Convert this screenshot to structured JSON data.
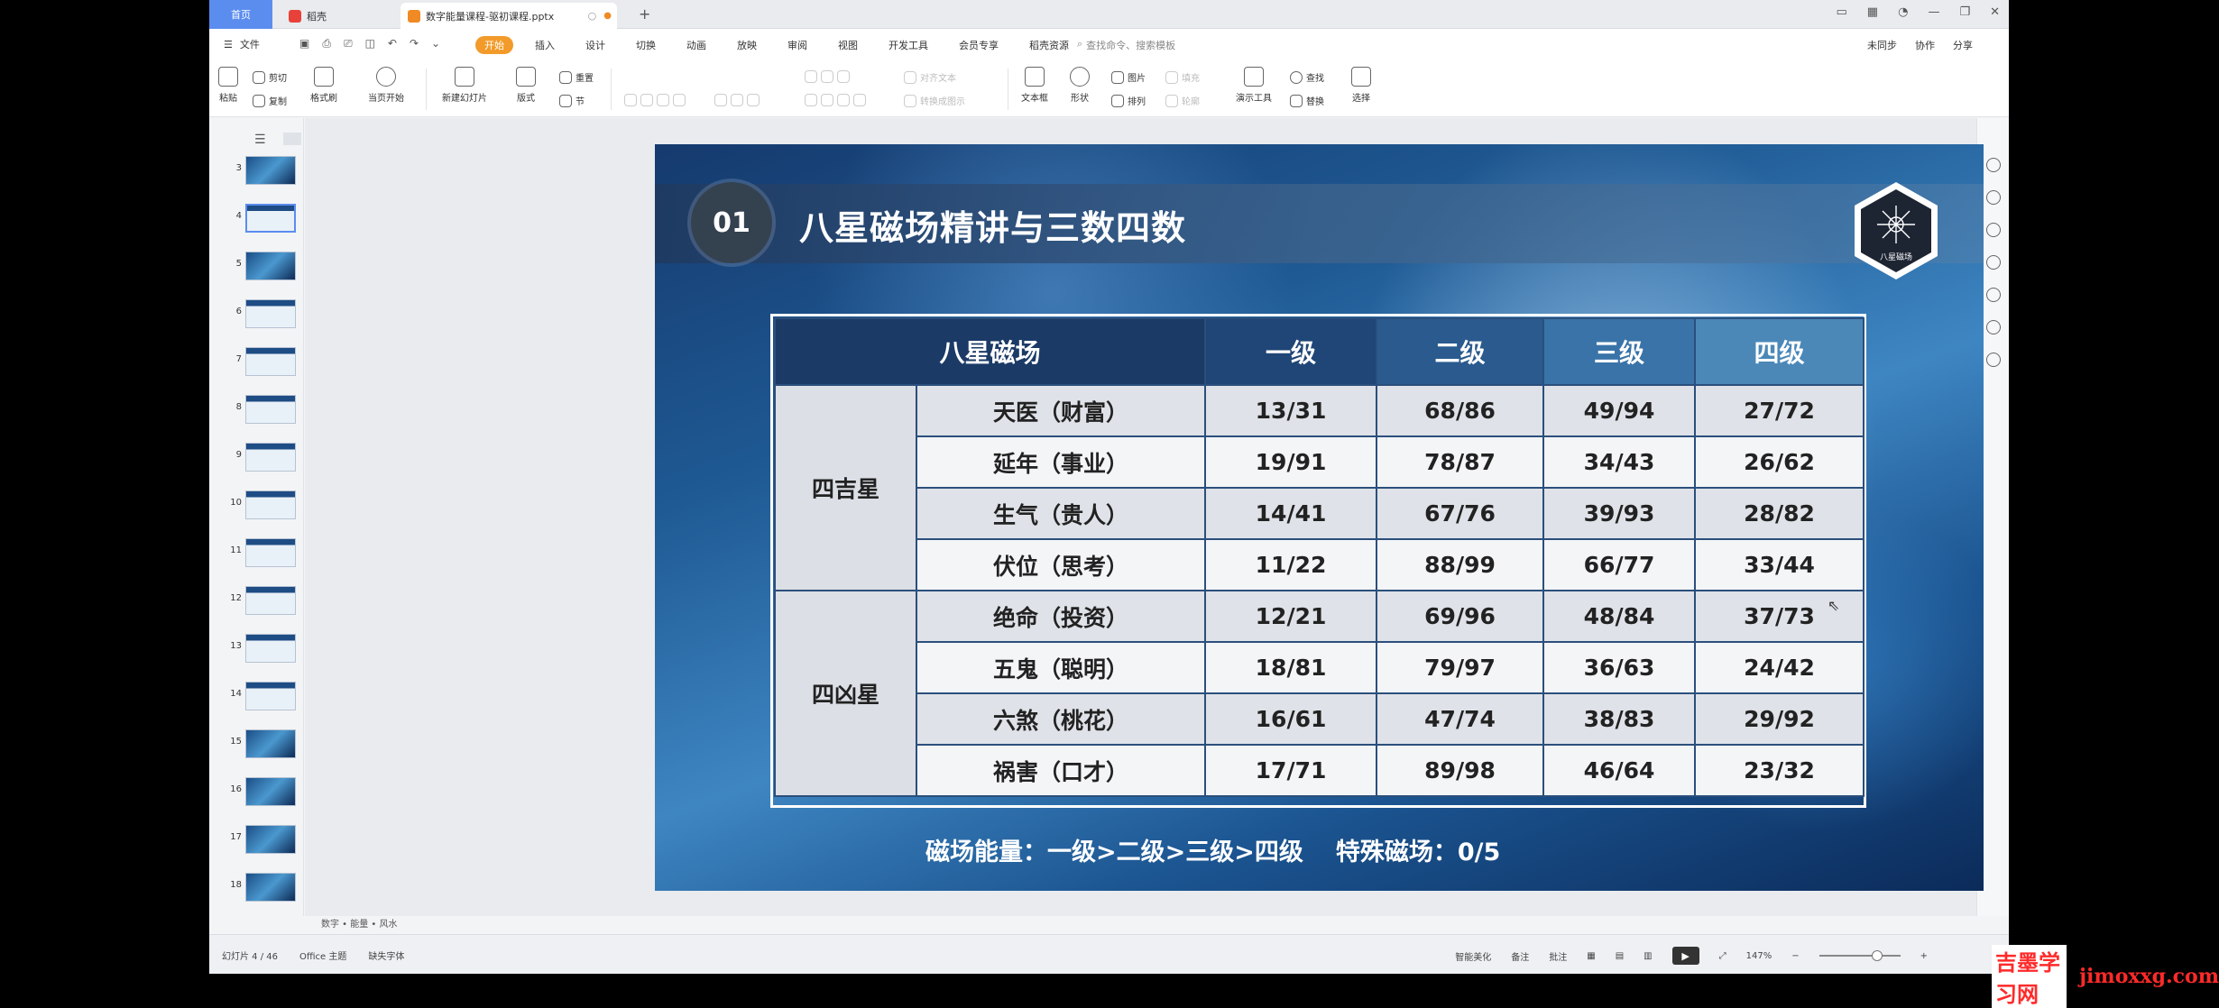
{
  "tabs": {
    "home": "首页",
    "docer": "稻壳",
    "active_doc": "数字能量课程-驱初课程.pptx",
    "add": "+"
  },
  "menu": {
    "file": "文件",
    "tabs": [
      "开始",
      "插入",
      "设计",
      "切换",
      "动画",
      "放映",
      "审阅",
      "视图",
      "开发工具",
      "会员专享",
      "稻壳资源"
    ],
    "active_tab": "开始",
    "search": "查找命令、搜索模板",
    "right": [
      "未同步",
      "协作",
      "分享"
    ]
  },
  "ribbon": {
    "paste": "粘贴",
    "cut": "剪切",
    "copy": "复制",
    "format_painter": "格式刷",
    "play": "当页开始",
    "new_slide": "新建幻灯片",
    "layout": "版式",
    "section": "节",
    "reset": "重置",
    "text_box": "文本框",
    "shape": "形状",
    "arrange": "排列",
    "outline": "轮廓",
    "picture": "图片",
    "fill": "填充",
    "present_tools": "演示工具",
    "find": "查找",
    "replace": "替换",
    "select": "选择",
    "convert_smartart": "转换成图示",
    "text_direction": "对齐文本"
  },
  "thumbnails": [
    {
      "num": "3",
      "style": "dark"
    },
    {
      "num": "4",
      "style": "light",
      "active": true
    },
    {
      "num": "5",
      "style": "dark"
    },
    {
      "num": "6",
      "style": "light"
    },
    {
      "num": "7",
      "style": "light"
    },
    {
      "num": "8",
      "style": "light"
    },
    {
      "num": "9",
      "style": "light"
    },
    {
      "num": "10",
      "style": "light"
    },
    {
      "num": "11",
      "style": "light"
    },
    {
      "num": "12",
      "style": "light"
    },
    {
      "num": "13",
      "style": "light"
    },
    {
      "num": "14",
      "style": "light"
    },
    {
      "num": "15",
      "style": "dark"
    },
    {
      "num": "16",
      "style": "dark"
    },
    {
      "num": "17",
      "style": "dark"
    },
    {
      "num": "18",
      "style": "dark"
    }
  ],
  "slide": {
    "badge": "01",
    "title": "八星磁场精讲与三数四数",
    "logo_text": "八星磁场",
    "table": {
      "headers": [
        "八星磁场",
        "一级",
        "二级",
        "三级",
        "四级"
      ],
      "groups": [
        {
          "name": "四吉星",
          "rows": [
            {
              "name": "天医（财富）",
              "values": [
                "13/31",
                "68/86",
                "49/94",
                "27/72"
              ]
            },
            {
              "name": "延年（事业）",
              "values": [
                "19/91",
                "78/87",
                "34/43",
                "26/62"
              ]
            },
            {
              "name": "生气（贵人）",
              "values": [
                "14/41",
                "67/76",
                "39/93",
                "28/82"
              ]
            },
            {
              "name": "伏位（思考）",
              "values": [
                "11/22",
                "88/99",
                "66/77",
                "33/44"
              ]
            }
          ]
        },
        {
          "name": "四凶星",
          "rows": [
            {
              "name": "绝命（投资）",
              "values": [
                "12/21",
                "69/96",
                "48/84",
                "37/73"
              ]
            },
            {
              "name": "五鬼（聪明）",
              "values": [
                "18/81",
                "79/97",
                "36/63",
                "24/42"
              ]
            },
            {
              "name": "六煞（桃花）",
              "values": [
                "16/61",
                "47/74",
                "38/83",
                "29/92"
              ]
            },
            {
              "name": "祸害（口才）",
              "values": [
                "17/71",
                "89/98",
                "46/64",
                "23/32"
              ]
            }
          ]
        }
      ]
    },
    "footer_left": "磁场能量：一级>二级>三级>四级",
    "footer_right": "特殊磁场：0/5"
  },
  "notes_label": "数字 • 能量 • 风水",
  "status": {
    "slide_info": "幻灯片 4 / 46",
    "theme": "Office 主题",
    "font_missing": "缺失字体",
    "smart_beautify": "智能美化",
    "notes": "备注",
    "comments": "批注",
    "zoom": "147%"
  },
  "watermark": {
    "cn": "吉墨学习网",
    "en": "jimoxxg.com"
  },
  "colors": {
    "accent_orange": "#f29b2a",
    "home_tab": "#5b8def",
    "watermark_red": "#ff2a2a"
  }
}
